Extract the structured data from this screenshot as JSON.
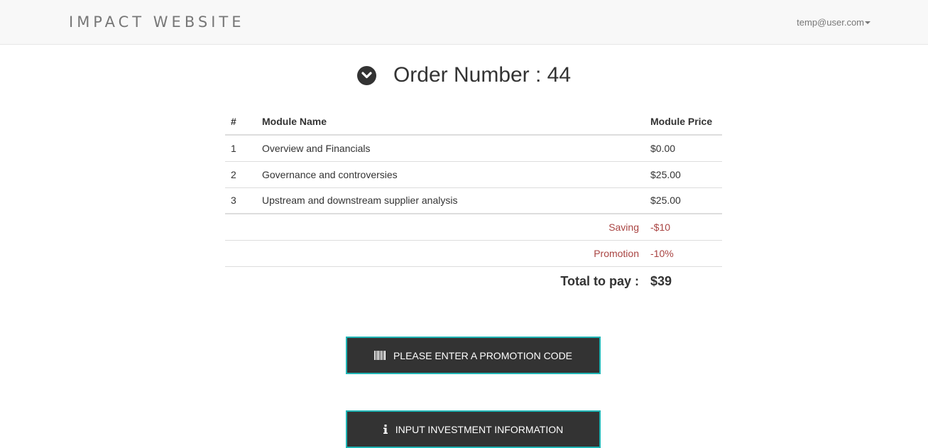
{
  "navbar": {
    "brand": "IMPACT WEBSITE",
    "user_email": "temp@user.com"
  },
  "order": {
    "title": "Order Number : 44"
  },
  "table": {
    "headers": [
      "#",
      "Module Name",
      "Module Price"
    ],
    "rows": [
      {
        "num": "1",
        "name": "Overview and Financials",
        "price": "$0.00"
      },
      {
        "num": "2",
        "name": "Governance and controversies",
        "price": "$25.00"
      },
      {
        "num": "3",
        "name": "Upstream and downstream supplier analysis",
        "price": "$25.00"
      }
    ],
    "saving": {
      "label": "Saving",
      "value": "-$10"
    },
    "promotion": {
      "label": "Promotion",
      "value": "-10%"
    },
    "total": {
      "label": "Total to pay :",
      "value": "$39"
    }
  },
  "buttons": {
    "promo_label": "PLEASE ENTER A PROMOTION CODE",
    "invest_label": "INPUT INVESTMENT INFORMATION"
  },
  "colors": {
    "accent_border": "#1fb5b5",
    "button_bg": "#333333",
    "discount_text": "#a94442"
  },
  "icons": {
    "order_toggle": "chevron-circle-down-icon",
    "promo": "barcode-icon",
    "invest": "info-icon",
    "user_menu": "caret-down-icon"
  }
}
